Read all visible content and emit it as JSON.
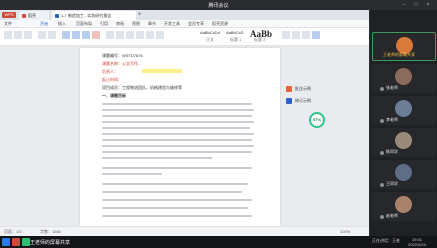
{
  "meeting": {
    "title": "腾讯会议"
  },
  "wps": {
    "home_label": "WPS",
    "tabs": [
      {
        "label": "稻壳",
        "color": "#d04a3a"
      },
      {
        "label": "1-7 制造加工...实务研究报告",
        "color": "#2a62c9"
      }
    ],
    "menu": [
      "文件",
      "开始",
      "插入",
      "页面布局",
      "引用",
      "审阅",
      "视图",
      "章节",
      "开发工具",
      "会员专享",
      "稻壳资源"
    ],
    "active_menu": "开始",
    "styles": [
      "AaBbCcDd",
      "AaBbCcD",
      "AaBb"
    ],
    "style_names": [
      "正文",
      "标题 1",
      "标题 2"
    ],
    "doc_lines": [
      {
        "text": "课题编号：WSTD7876",
        "type": "meta"
      },
      {
        "text": "课题名称：公文写作...",
        "type": "meta"
      },
      {
        "text": "负责人：",
        "type": "meta"
      },
      {
        "text": "起止时间：",
        "type": "meta"
      },
      {
        "text": "项目成员：工程物流团队，机械建造与维修等",
        "type": "meta"
      },
      {
        "text": "一、课题目标",
        "type": "heading"
      }
    ],
    "side_panel": [
      {
        "label": "批注示例",
        "color": "#e8603c"
      },
      {
        "label": "修订示例",
        "color": "#2a62c9"
      }
    ],
    "progress_percent": 57,
    "progress_label": "57%",
    "status": {
      "page": "页面：1/3",
      "words": "字数：1580",
      "zoom": "100%"
    }
  },
  "participants": [
    {
      "name": "王老师的屏幕共享",
      "avatar_color": "#d97a3a",
      "is_host": true
    },
    {
      "name": "张老师",
      "avatar_color": "#8a6b5c",
      "is_host": false
    },
    {
      "name": "李老师",
      "avatar_color": "#6b7e96",
      "is_host": false
    },
    {
      "name": "陈同学",
      "avatar_color": "#9b8a7a",
      "is_host": false
    },
    {
      "name": "王同学",
      "avatar_color": "#5d6e86",
      "is_host": false
    },
    {
      "name": "赵老师",
      "avatar_color": "#a8836a",
      "is_host": false
    },
    {
      "name": "刘同学",
      "avatar_color": "#6f7f6a",
      "is_host": false
    }
  ],
  "taskbar": {
    "speaker": "王老师的屏幕共享",
    "tray_left": "正在讲话：王老",
    "time": "19:31",
    "date": "2022/4/24"
  },
  "icons": {
    "start": "windows-start-icon",
    "mic": "microphone-icon",
    "minimize": "minimize-icon",
    "maximize": "maximize-icon",
    "close": "close-icon"
  }
}
